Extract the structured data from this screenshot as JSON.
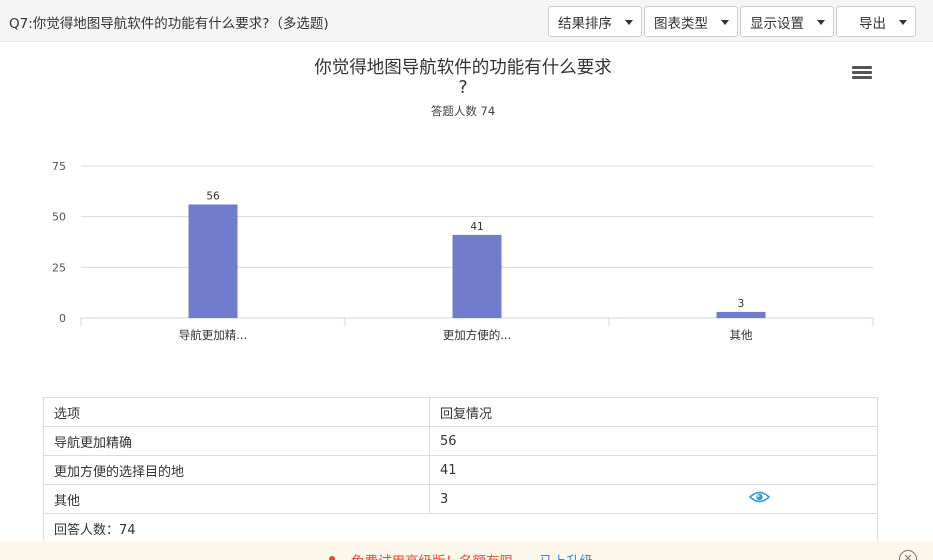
{
  "header": {
    "question_title": "Q7:你觉得地图导航软件的功能有什么要求?（多选题)",
    "buttons": [
      {
        "label": "结果排序"
      },
      {
        "label": "图表类型"
      },
      {
        "label": "显示设置"
      },
      {
        "label": "导出"
      }
    ]
  },
  "chart": {
    "title_line1": "你觉得地图导航软件的功能有什么要求",
    "title_line2": "?",
    "subtitle": "答题人数 74"
  },
  "chart_data": {
    "type": "bar",
    "title": "你觉得地图导航软件的功能有什么要求?",
    "subtitle": "答题人数 74",
    "categories": [
      "导航更加精...",
      "更加方便的...",
      "其他"
    ],
    "values": [
      56,
      41,
      3
    ],
    "yticks": [
      0,
      25,
      50,
      75
    ],
    "ylim": [
      0,
      75
    ],
    "grid": true,
    "bar_color": "#727ccd"
  },
  "table": {
    "headers": [
      "选项",
      "回复情况"
    ],
    "rows": [
      {
        "option": "导航更加精确",
        "count": "56"
      },
      {
        "option": "更加方便的选择目的地",
        "count": "41"
      },
      {
        "option": "其他",
        "count": "3"
      }
    ],
    "footer": "回答人数：74"
  },
  "banner": {
    "message": "免费试用高级版！名额有限",
    "link": "马上升级",
    "close": "✕"
  },
  "icons": {
    "menu": "hamburger-menu-icon",
    "eye": "eye-icon",
    "caret": "caret-down-icon"
  }
}
